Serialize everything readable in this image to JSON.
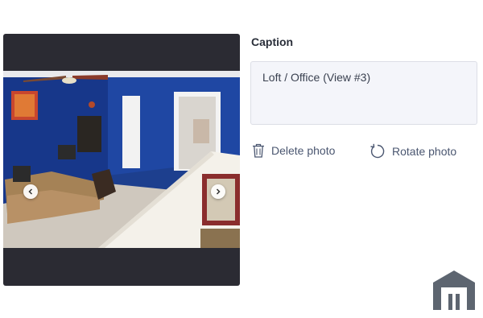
{
  "photo": {
    "prev_icon": "chevron-left-icon",
    "next_icon": "chevron-right-icon"
  },
  "caption": {
    "label": "Caption",
    "value": "Loft / Office (View #3)"
  },
  "actions": {
    "delete_label": "Delete photo",
    "delete_icon": "trash-icon",
    "rotate_label": "Rotate photo",
    "rotate_icon": "rotate-icon"
  },
  "brand": {
    "icon": "house-outline-logo"
  },
  "colors": {
    "photo_frame": "#2b2b33",
    "caption_bg": "#f4f5fa",
    "action_text": "#4a5670"
  }
}
